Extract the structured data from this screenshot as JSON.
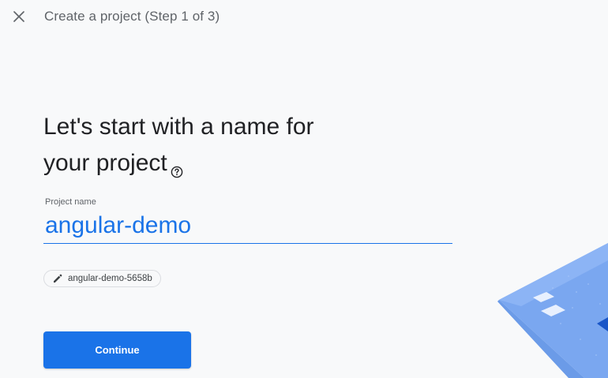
{
  "header": {
    "title": "Create a project (Step 1 of 3)"
  },
  "main": {
    "heading_line1": "Let's start with a name for",
    "heading_line2": "your project"
  },
  "project_name_field": {
    "label": "Project name",
    "value": "angular-demo"
  },
  "project_id_chip": {
    "text": "angular-demo-5658b"
  },
  "actions": {
    "continue_label": "Continue"
  },
  "colors": {
    "accent": "#1a73e8",
    "background": "#f8f9fa",
    "text_primary": "#202124",
    "text_secondary": "#5f6368"
  },
  "icons": {
    "close": "close-icon",
    "help": "help-circle-icon",
    "edit": "pencil-icon"
  }
}
